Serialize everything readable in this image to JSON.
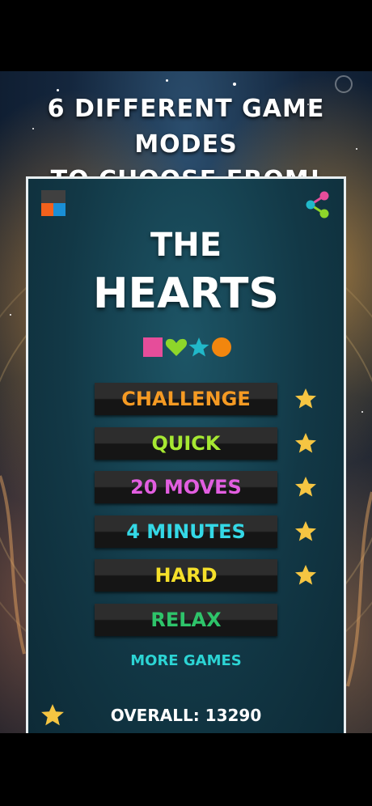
{
  "promo": {
    "headline_line1": "6 DIFFERENT GAME MODES",
    "headline_line2": "TO CHOOSE FROM!"
  },
  "game": {
    "title_line1": "THE",
    "title_line2": "HEARTS",
    "title_shapes": [
      {
        "shape": "square",
        "color": "#e64d9a"
      },
      {
        "shape": "heart",
        "color": "#8ed62a"
      },
      {
        "shape": "star",
        "color": "#21b8c9"
      },
      {
        "shape": "circle",
        "color": "#f2860e"
      }
    ],
    "logo_colors": [
      "#404040",
      "#404040",
      "#f2611c",
      "#1a8fd6"
    ],
    "share_icon": "share-icon",
    "modes": [
      {
        "label": "CHALLENGE",
        "color": "#f59a23",
        "starred": true
      },
      {
        "label": "QUICK",
        "color": "#a6e832",
        "starred": true
      },
      {
        "label": "20 MOVES",
        "color": "#e25ee0",
        "starred": true
      },
      {
        "label": "4 MINUTES",
        "color": "#34d8e6",
        "starred": true
      },
      {
        "label": "HARD",
        "color": "#f5e02a",
        "starred": true
      },
      {
        "label": "RELAX",
        "color": "#2ec46a",
        "starred": false
      }
    ],
    "star_color": "#f5c542",
    "more_games": "MORE GAMES",
    "overall": "OVERALL: 13290"
  }
}
